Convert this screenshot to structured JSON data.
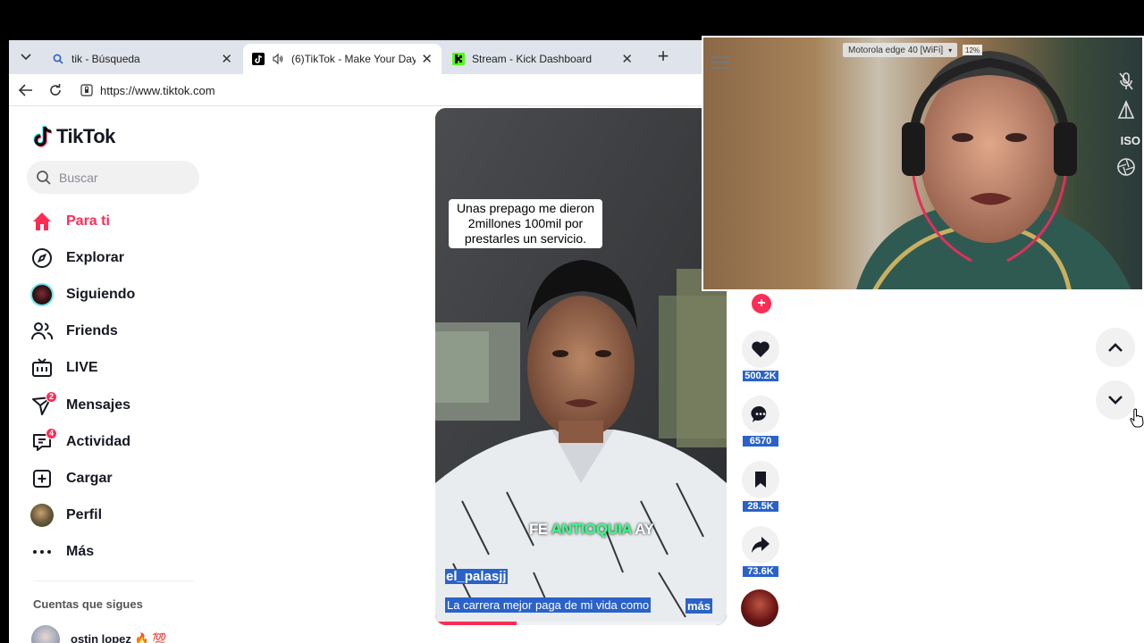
{
  "browser": {
    "tabs": [
      {
        "title": "tik - Búsqueda",
        "favicon": "search-icon"
      },
      {
        "title": "(6)TikTok - Make Your Day",
        "favicon": "tiktok-icon",
        "audio": true
      },
      {
        "title": "Stream - Kick Dashboard",
        "favicon": "kick-icon"
      }
    ],
    "url": "https://www.tiktok.com"
  },
  "sidebar": {
    "logo": "TikTok",
    "search_placeholder": "Buscar",
    "nav": [
      {
        "label": "Para ti",
        "icon": "home-icon",
        "active": true
      },
      {
        "label": "Explorar",
        "icon": "compass-icon"
      },
      {
        "label": "Siguiendo",
        "icon": "avatar-icon"
      },
      {
        "label": "Friends",
        "icon": "friends-icon"
      },
      {
        "label": "LIVE",
        "icon": "live-tv-icon"
      },
      {
        "label": "Mensajes",
        "icon": "messages-icon",
        "badge": "2"
      },
      {
        "label": "Actividad",
        "icon": "activity-icon",
        "badge": "4"
      },
      {
        "label": "Cargar",
        "icon": "upload-icon"
      },
      {
        "label": "Perfil",
        "icon": "profile-icon"
      },
      {
        "label": "Más",
        "icon": "more-icon"
      }
    ],
    "following_title": "Cuentas que sigues",
    "following": [
      {
        "name": "ostin lopez 🔥 💯"
      }
    ]
  },
  "video": {
    "caption": "Unas prepago me dieron 2millones 100mil por prestarles un servicio.",
    "subtitle_part1": "FE",
    "subtitle_highlight": "ANTIOQUIA",
    "subtitle_part2": "AY",
    "author": "el_palasjj",
    "description": "La carrera mejor paga de mi vida como",
    "more": "más",
    "progress": 0.28
  },
  "actions": {
    "likes": "500.2K",
    "comments": "6570",
    "saves": "28.5K",
    "shares": "73.6K"
  },
  "webcam": {
    "device": "Motorola edge 40 [WiFi]",
    "percent": "12%",
    "iso": "ISO"
  },
  "colors": {
    "accent": "#fe2c55",
    "selection": "#2a62c9"
  }
}
